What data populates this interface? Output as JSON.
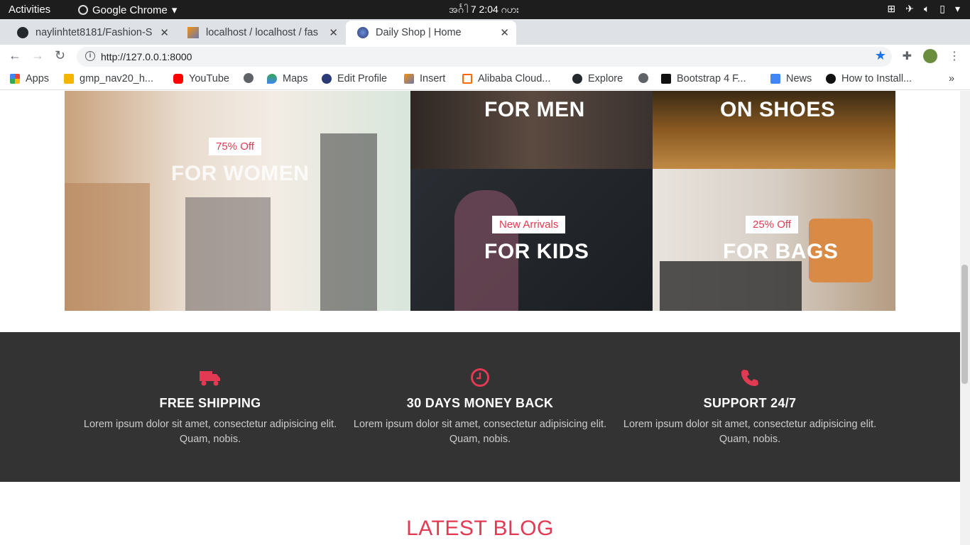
{
  "os": {
    "activities": "Activities",
    "app": "Google Chrome",
    "clock": "အင်္ဂါ 7   2:04 ဂဟး"
  },
  "tabs": [
    {
      "title": "naylinhtet8181/Fashion-S"
    },
    {
      "title": "localhost / localhost / fas"
    },
    {
      "title": "Daily Shop | Home"
    }
  ],
  "address": {
    "url": "http://127.0.0.1:8000"
  },
  "bookmarks": {
    "apps": "Apps",
    "gmp": "gmp_nav20_h...",
    "youtube": "YouTube",
    "maps": "Maps",
    "edit_profile": "Edit Profile",
    "insert": "Insert",
    "alibaba": "Alibaba Cloud...",
    "explore": "Explore",
    "bootstrap": "Bootstrap 4 F...",
    "news": "News",
    "howto": "How to Install..."
  },
  "promos": {
    "women": {
      "tag": "75% Off",
      "title": "FOR WOMEN"
    },
    "men": {
      "title": "FOR MEN"
    },
    "shoes": {
      "title": "ON SHOES"
    },
    "kids": {
      "tag": "New Arrivals",
      "title": "FOR KIDS"
    },
    "bags": {
      "tag": "25% Off",
      "title": "FOR BAGS"
    }
  },
  "features": [
    {
      "title": "FREE SHIPPING",
      "text": "Lorem ipsum dolor sit amet, consectetur adipisicing elit. Quam, nobis.",
      "icon": "truck-icon"
    },
    {
      "title": "30 DAYS MONEY BACK",
      "text": "Lorem ipsum dolor sit amet, consectetur adipisicing elit. Quam, nobis.",
      "icon": "clock-icon"
    },
    {
      "title": "SUPPORT 24/7",
      "text": "Lorem ipsum dolor sit amet, consectetur adipisicing elit. Quam, nobis.",
      "icon": "phone-icon"
    }
  ],
  "blog": {
    "heading": "LATEST BLOG"
  },
  "colors": {
    "accent": "#e23a52",
    "feature_bg": "#333333"
  }
}
